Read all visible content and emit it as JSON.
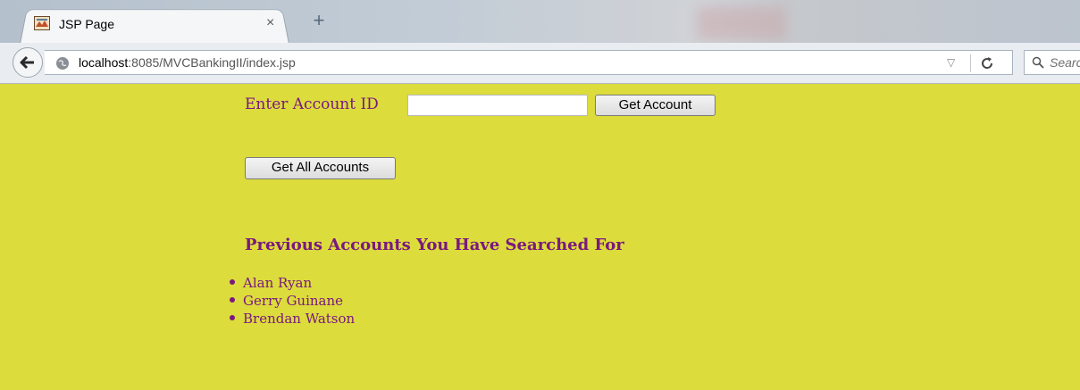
{
  "browser": {
    "tab_title": "JSP Page",
    "tab_close": "×",
    "new_tab": "+",
    "url_host": "localhost",
    "url_rest": ":8085/MVCBankingII/index.jsp",
    "search_placeholder": "Search",
    "reload_glyph": "C",
    "dropmark": "▽"
  },
  "form": {
    "account_label": "Enter Account ID",
    "account_value": "",
    "get_account_label": "Get Account",
    "get_all_label": "Get All Accounts"
  },
  "history": {
    "heading": "Previous Accounts You Have Searched For",
    "items": [
      "Alan Ryan",
      "Gerry Guinane",
      "Brendan Watson"
    ]
  },
  "colors": {
    "page_background": "#dcdc3c",
    "text_accent": "#7a1880"
  }
}
